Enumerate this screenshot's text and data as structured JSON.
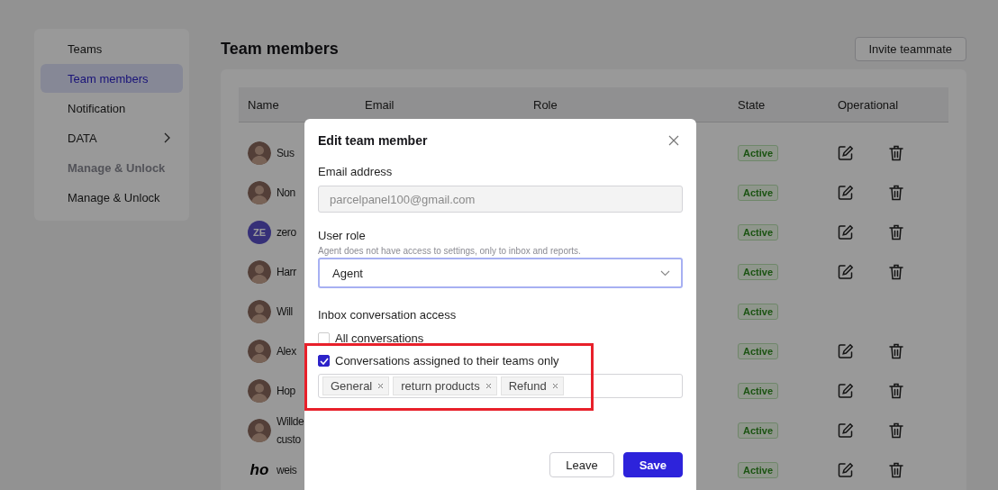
{
  "sidebar": {
    "items": [
      {
        "label": "Teams",
        "selected": false,
        "disabled": false,
        "has_submenu": false
      },
      {
        "label": "Team members",
        "selected": true,
        "disabled": false,
        "has_submenu": false
      },
      {
        "label": "Notification",
        "selected": false,
        "disabled": false,
        "has_submenu": false
      },
      {
        "label": "DATA",
        "selected": false,
        "disabled": false,
        "has_submenu": true
      },
      {
        "label": "Manage & Unlock",
        "selected": false,
        "disabled": true,
        "has_submenu": false
      },
      {
        "label": "Manage & Unlock",
        "selected": false,
        "disabled": false,
        "has_submenu": false
      }
    ]
  },
  "page": {
    "title": "Team members",
    "invite_button": "Invite teammate"
  },
  "table": {
    "columns": [
      "Name",
      "Email",
      "Role",
      "State",
      "Operational"
    ],
    "rows": [
      {
        "avatar": {
          "kind": "photo"
        },
        "name_lines": [
          "Sus"
        ],
        "state": "Active",
        "editable": true
      },
      {
        "avatar": {
          "kind": "photo"
        },
        "name_lines": [
          "Non"
        ],
        "state": "Active",
        "editable": true
      },
      {
        "avatar": {
          "kind": "initials",
          "text": "ZE"
        },
        "name_lines": [
          "zero"
        ],
        "state": "Active",
        "editable": true
      },
      {
        "avatar": {
          "kind": "photo"
        },
        "name_lines": [
          "Harr"
        ],
        "state": "Active",
        "editable": true
      },
      {
        "avatar": {
          "kind": "photo"
        },
        "name_lines": [
          "Will"
        ],
        "state": "Active",
        "editable": false
      },
      {
        "avatar": {
          "kind": "photo"
        },
        "name_lines": [
          "Alex"
        ],
        "state": "Active",
        "editable": true
      },
      {
        "avatar": {
          "kind": "photo"
        },
        "name_lines": [
          "Hop"
        ],
        "state": "Active",
        "editable": true
      },
      {
        "avatar": {
          "kind": "photo"
        },
        "name_lines": [
          "Willde",
          "custo"
        ],
        "state": "Active",
        "editable": true
      },
      {
        "avatar": {
          "kind": "logo",
          "text": "ho"
        },
        "name_lines": [
          "weis"
        ],
        "state": "Active",
        "editable": true
      }
    ]
  },
  "dialog": {
    "title": "Edit team member",
    "email": {
      "label": "Email address",
      "value": "parcelpanel100@gmail.com",
      "disabled": true
    },
    "role": {
      "label": "User role",
      "hint": "Agent does not have access to settings, only to inbox and reports.",
      "value": "Agent",
      "focused": true
    },
    "access": {
      "label": "Inbox conversation access",
      "options": [
        {
          "label": "All conversations",
          "checked": false
        },
        {
          "label": "Conversations assigned to their teams only",
          "checked": true
        }
      ],
      "tags": [
        "General",
        "return products",
        "Refund"
      ]
    },
    "buttons": [
      {
        "label": "Leave",
        "kind": "secondary"
      },
      {
        "label": "Save",
        "kind": "primary"
      }
    ]
  },
  "annotation": {
    "kind": "frame"
  }
}
